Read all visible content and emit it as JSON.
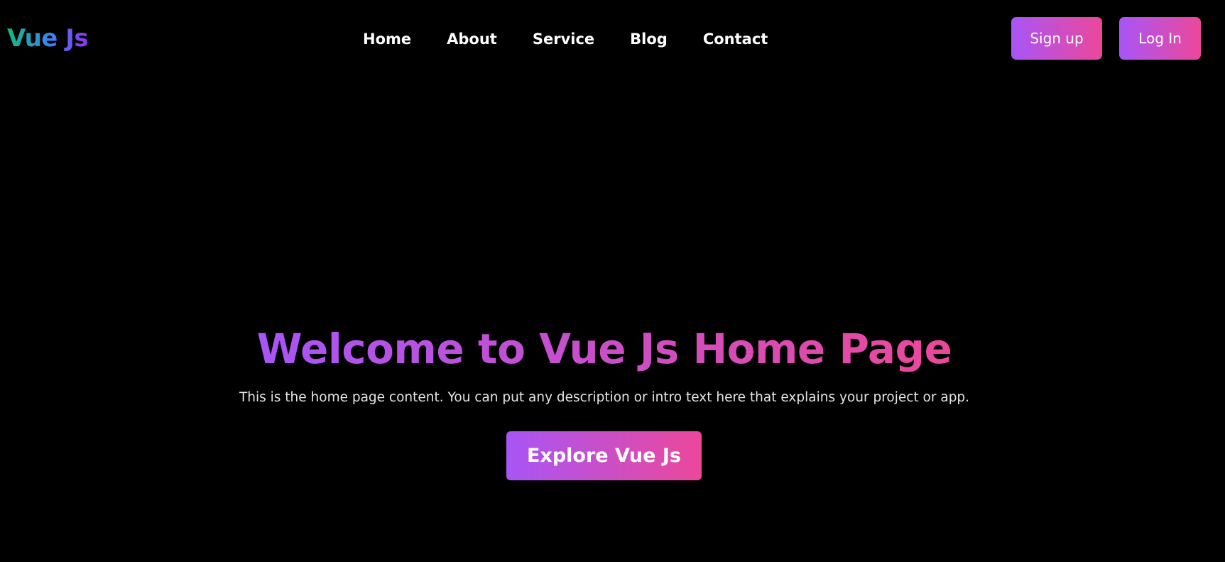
{
  "header": {
    "logo": "Vue Js",
    "nav": [
      {
        "label": "Home"
      },
      {
        "label": "About"
      },
      {
        "label": "Service"
      },
      {
        "label": "Blog"
      },
      {
        "label": "Contact"
      }
    ],
    "signup_label": "Sign up",
    "login_label": "Log In"
  },
  "hero": {
    "title": "Welcome to Vue Js Home Page",
    "description": "This is the home page content. You can put any description or intro text here that explains your project or app.",
    "cta_label": "Explore Vue Js"
  },
  "colors": {
    "background": "#000000",
    "gradient_start": "#a855f7",
    "gradient_end": "#ec4899",
    "logo_gradient": [
      "#10b981",
      "#3b82f6",
      "#9333ea"
    ],
    "text": "#ffffff"
  }
}
